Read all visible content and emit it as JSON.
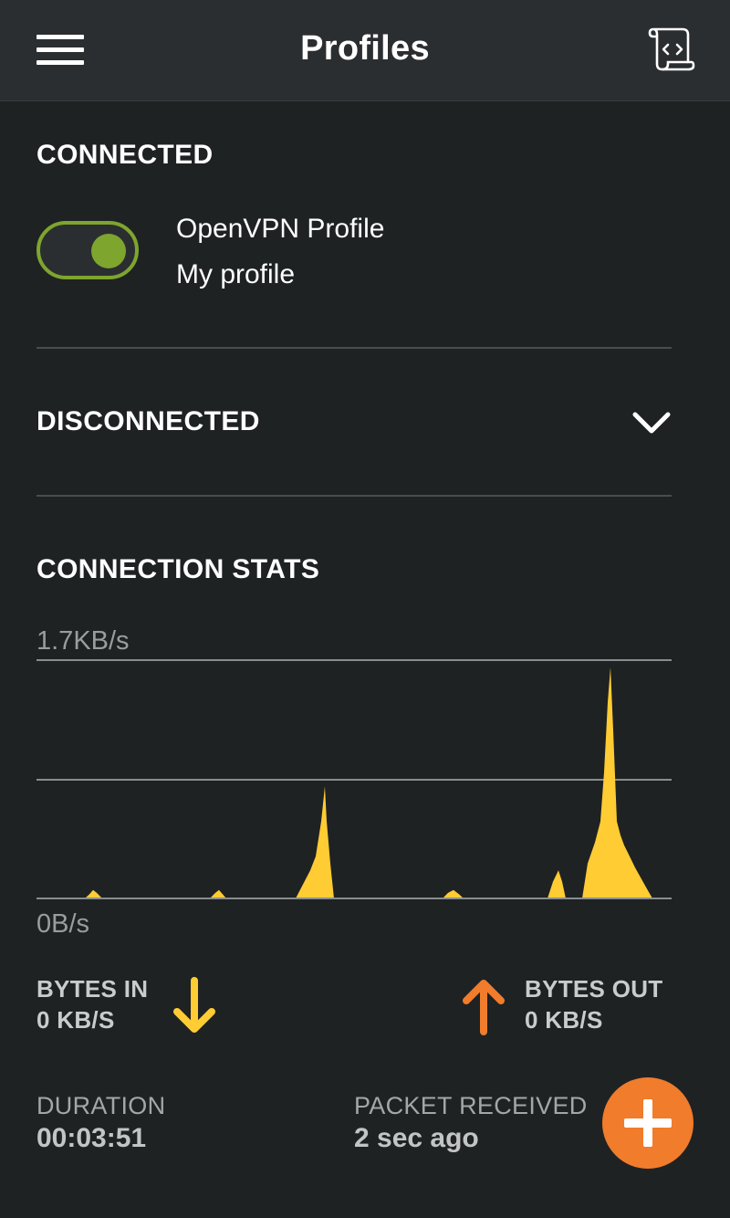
{
  "header": {
    "title": "Profiles",
    "menu_icon": "hamburger-menu-icon",
    "log_icon": "log-scroll-icon"
  },
  "connected": {
    "heading": "CONNECTED",
    "profile": {
      "name": "OpenVPN Profile",
      "subtitle": "My profile",
      "toggle_on": true
    }
  },
  "disconnected": {
    "heading": "DISCONNECTED",
    "expand_icon": "chevron-down-icon"
  },
  "stats": {
    "heading": "CONNECTION STATS",
    "bytes_in": {
      "label": "BYTES IN",
      "value": "0 KB/S",
      "icon": "arrow-down-icon"
    },
    "bytes_out": {
      "label": "BYTES OUT",
      "value": "0 KB/S",
      "icon": "arrow-up-icon"
    },
    "duration": {
      "label": "DURATION",
      "value": "00:03:51"
    },
    "packet_received": {
      "label": "PACKET RECEIVED",
      "value": "2 sec ago"
    }
  },
  "fab": {
    "icon": "plus-icon"
  },
  "colors": {
    "accent_green": "#7ea52e",
    "bytes_in": "#ffcc33",
    "bytes_out": "#f07c2c",
    "fab": "#f07c2c"
  },
  "chart_data": {
    "type": "area",
    "ylim": [
      0,
      1.7
    ],
    "ymax_label": "1.7KB/s",
    "ymin_label": "0B/s",
    "series": [
      {
        "values": [
          [
            0,
            0
          ],
          [
            53,
            0
          ],
          [
            58,
            0.03
          ],
          [
            62,
            0.06
          ],
          [
            66,
            0.04
          ],
          [
            72,
            0
          ],
          [
            190,
            0
          ],
          [
            196,
            0.04
          ],
          [
            200,
            0.06
          ],
          [
            204,
            0.03
          ],
          [
            208,
            0
          ],
          [
            284,
            0
          ],
          [
            292,
            0.1
          ],
          [
            300,
            0.2
          ],
          [
            306,
            0.3
          ],
          [
            312,
            0.55
          ],
          [
            316,
            0.8
          ],
          [
            318,
            0.55
          ],
          [
            322,
            0.25
          ],
          [
            326,
            0
          ],
          [
            445,
            0
          ],
          [
            451,
            0.04
          ],
          [
            457,
            0.06
          ],
          [
            463,
            0.03
          ],
          [
            468,
            0
          ],
          [
            560,
            0
          ],
          [
            566,
            0.12
          ],
          [
            572,
            0.2
          ],
          [
            576,
            0.12
          ],
          [
            580,
            0
          ],
          [
            598,
            0
          ],
          [
            604,
            0.25
          ],
          [
            612,
            0.4
          ],
          [
            618,
            0.55
          ],
          [
            622,
            0.9
          ],
          [
            626,
            1.4
          ],
          [
            629,
            1.65
          ],
          [
            632,
            1.2
          ],
          [
            636,
            0.55
          ],
          [
            640,
            0.45
          ],
          [
            644,
            0.38
          ],
          [
            650,
            0.3
          ],
          [
            656,
            0.22
          ],
          [
            662,
            0.15
          ],
          [
            668,
            0.08
          ],
          [
            675,
            0
          ],
          [
            700,
            0
          ]
        ]
      }
    ]
  }
}
